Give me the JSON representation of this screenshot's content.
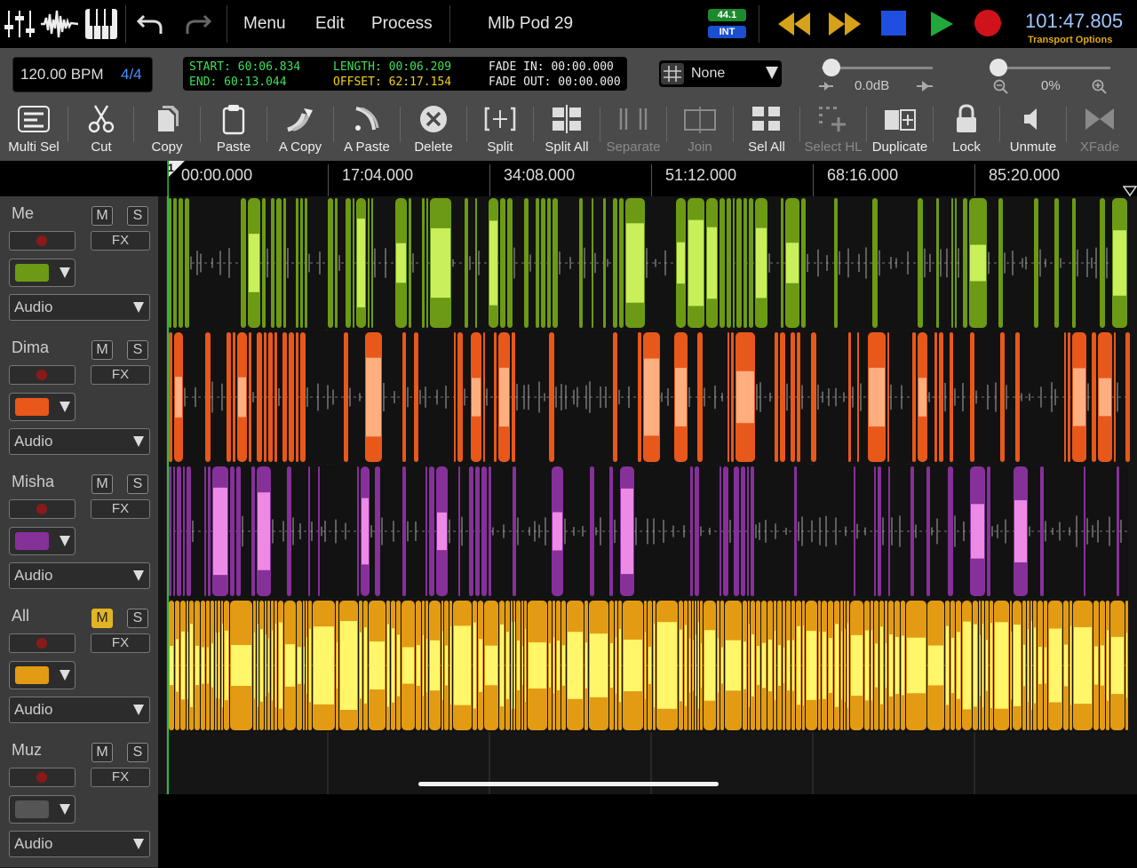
{
  "topbar": {
    "menu_label": "Menu",
    "edit_label": "Edit",
    "process_label": "Process",
    "project_title": "Mlb Pod 29",
    "sample_rate": "44.1",
    "clock_source": "INT",
    "clock": "101:47.805",
    "transport_options": "Transport Options",
    "icons": [
      "mixer-icon",
      "waveform-icon",
      "keyboard-icon",
      "undo-icon",
      "redo-icon",
      "rewind-icon",
      "fast-forward-icon",
      "stop-icon",
      "play-icon",
      "record-icon"
    ],
    "colors": {
      "stop": "#1e4fe0",
      "play": "#22a83a",
      "record": "#d0121a",
      "rewind": "#d6a21a",
      "clock": "#9fc6ff"
    }
  },
  "info": {
    "bpm": "120.00 BPM",
    "time_signature": "4/4",
    "start": "START: 60:06.834",
    "end": "END: 60:13.044",
    "length": "LENGTH: 00:06.209",
    "offset": "OFFSET: 62:17.154",
    "fade_in": "FADE IN: 00:00.000",
    "fade_out": "FADE OUT: 00:00.000",
    "snap": "None",
    "volume": "0.0dB",
    "zoom": "0%"
  },
  "toolbar": {
    "tools": [
      {
        "label": "Multi Sel",
        "icon": "multi-select-icon",
        "enabled": true
      },
      {
        "label": "Cut",
        "icon": "scissors-icon",
        "enabled": true
      },
      {
        "label": "Copy",
        "icon": "copy-icon",
        "enabled": true
      },
      {
        "label": "Paste",
        "icon": "clipboard-icon",
        "enabled": true
      },
      {
        "label": "A Copy",
        "icon": "audio-copy-icon",
        "enabled": true
      },
      {
        "label": "A Paste",
        "icon": "audio-paste-icon",
        "enabled": true
      },
      {
        "label": "Delete",
        "icon": "delete-icon",
        "enabled": true
      },
      {
        "label": "Split",
        "icon": "split-icon",
        "enabled": true
      },
      {
        "label": "Split All",
        "icon": "split-all-icon",
        "enabled": true
      },
      {
        "label": "Separate",
        "icon": "separate-icon",
        "enabled": false
      },
      {
        "label": "Join",
        "icon": "join-icon",
        "enabled": false
      },
      {
        "label": "Sel All",
        "icon": "select-all-icon",
        "enabled": true
      },
      {
        "label": "Select HL",
        "icon": "select-hl-icon",
        "enabled": false
      },
      {
        "label": "Duplicate",
        "icon": "duplicate-icon",
        "enabled": true
      },
      {
        "label": "Lock",
        "icon": "lock-icon",
        "enabled": true
      },
      {
        "label": "Unmute",
        "icon": "speaker-icon",
        "enabled": true
      },
      {
        "label": "XFade",
        "icon": "crossfade-icon",
        "enabled": false
      }
    ]
  },
  "ruler": {
    "marker": "1",
    "labels": [
      "00:00.000",
      "17:04.000",
      "34:08.000",
      "51:12.000",
      "68:16.000",
      "85:20.000"
    ]
  },
  "tracks": [
    {
      "name": "Me",
      "mute": "M",
      "solo": "S",
      "muted": false,
      "fx": "FX",
      "type": "Audio",
      "color": "#6c9a14",
      "light": "#c9ef5a"
    },
    {
      "name": "Dima",
      "mute": "M",
      "solo": "S",
      "muted": false,
      "fx": "FX",
      "type": "Audio",
      "color": "#e8581a",
      "light": "#ffae80"
    },
    {
      "name": "Misha",
      "mute": "M",
      "solo": "S",
      "muted": false,
      "fx": "FX",
      "type": "Audio",
      "color": "#86309a",
      "light": "#ec8ae6"
    },
    {
      "name": "All",
      "mute": "M",
      "solo": "S",
      "muted": true,
      "fx": "FX",
      "type": "Audio",
      "color": "#e29b12",
      "light": "#fff66a"
    },
    {
      "name": "Muz",
      "mute": "M",
      "solo": "S",
      "muted": false,
      "fx": "FX",
      "type": "Audio",
      "color": "#555555",
      "light": "#777777"
    }
  ]
}
